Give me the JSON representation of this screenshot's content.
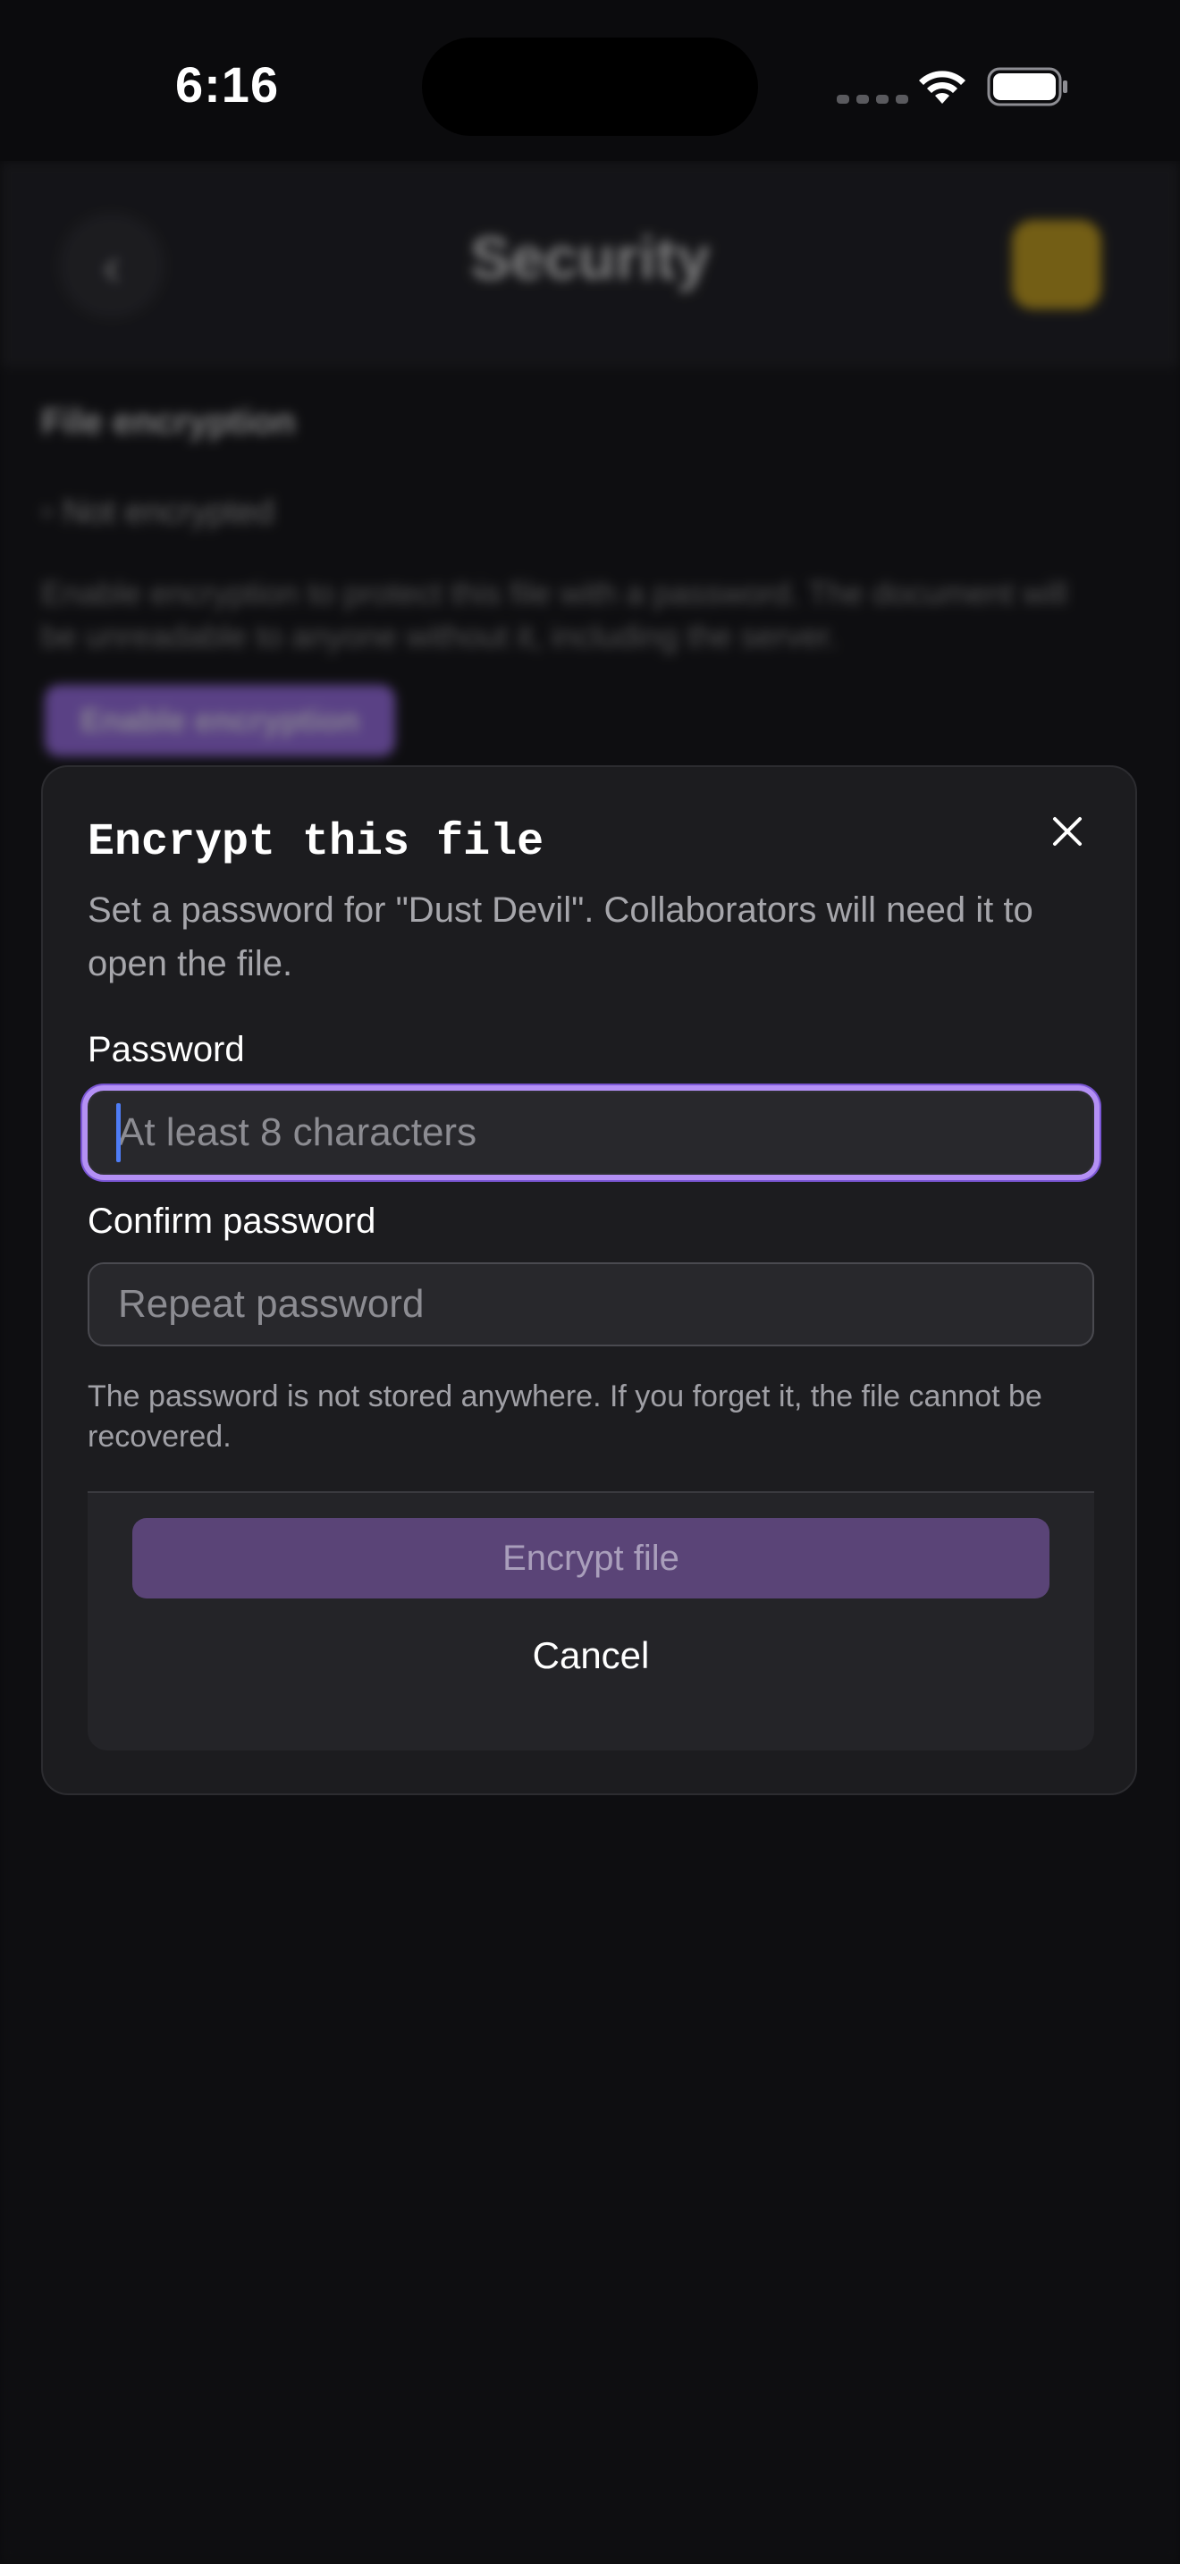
{
  "status_bar": {
    "time": "6:16"
  },
  "background": {
    "title": "Security",
    "section_title": "File encryption",
    "status": "Not encrypted",
    "description": "Enable encryption to protect this file with a password. The document will be unreadable to anyone without it, including the server.",
    "enable_button_label": "Enable encryption",
    "avatar_color": "#c9a21d"
  },
  "modal": {
    "title": "Encrypt this file",
    "subtitle": "Set a password for \"Dust Devil\". Collaborators will need it to open the file.",
    "password_label": "Password",
    "password_placeholder": "At least 8 characters",
    "password_value": "",
    "confirm_label": "Confirm password",
    "confirm_placeholder": "Repeat password",
    "confirm_value": "",
    "hint": "The password is not stored anywhere. If you forget it, the file cannot be recovered.",
    "encrypt_button_label": "Encrypt file",
    "cancel_button_label": "Cancel",
    "close_icon": "close-icon"
  },
  "colors": {
    "focus_ring": "#b490f5",
    "encrypt_button_disabled": "#5a4477",
    "caret": "#4e7cf6",
    "modal_background": "#1c1c1f"
  }
}
